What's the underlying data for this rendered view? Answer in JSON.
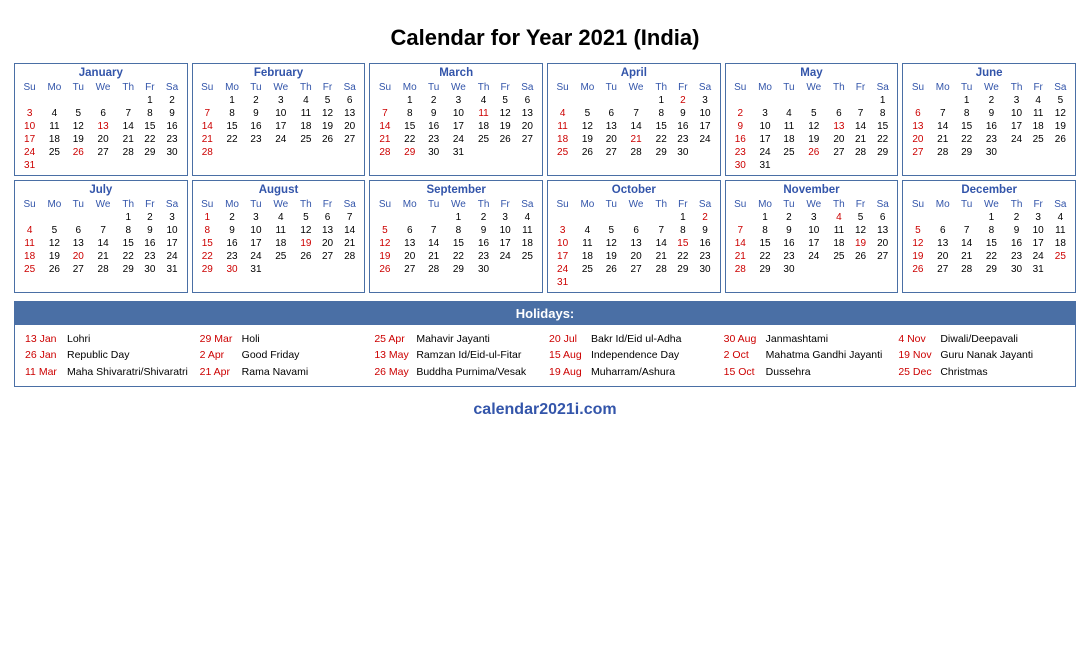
{
  "title": "Calendar for Year 2021 (India)",
  "months": [
    {
      "name": "January",
      "weeks": [
        [
          "",
          "",
          "",
          "",
          "",
          "1",
          "2"
        ],
        [
          "3",
          "4",
          "5",
          "6",
          "7",
          "8",
          "9"
        ],
        [
          "10",
          "11",
          "12",
          "13r",
          "14",
          "15",
          "16"
        ],
        [
          "17",
          "18",
          "19",
          "20",
          "21",
          "22",
          "23"
        ],
        [
          "24",
          "25",
          "26r",
          "27",
          "28",
          "29",
          "30"
        ],
        [
          "31",
          "",
          "",
          "",
          "",
          "",
          ""
        ]
      ]
    },
    {
      "name": "February",
      "weeks": [
        [
          "",
          "1",
          "2",
          "3",
          "4",
          "5",
          "6"
        ],
        [
          "7",
          "8",
          "9",
          "10",
          "11",
          "12",
          "13"
        ],
        [
          "14",
          "15",
          "16",
          "17",
          "18",
          "19",
          "20"
        ],
        [
          "21",
          "22",
          "23",
          "24",
          "25",
          "26",
          "27"
        ],
        [
          "28",
          "",
          "",
          "",
          "",
          "",
          ""
        ]
      ]
    },
    {
      "name": "March",
      "weeks": [
        [
          "",
          "1",
          "2",
          "3",
          "4",
          "5",
          "6"
        ],
        [
          "7",
          "8",
          "9",
          "10",
          "11r",
          "12",
          "13"
        ],
        [
          "14",
          "15",
          "16",
          "17",
          "18",
          "19",
          "20"
        ],
        [
          "21",
          "22",
          "23",
          "24",
          "25",
          "26",
          "27"
        ],
        [
          "28",
          "29r",
          "30",
          "31",
          "",
          "",
          ""
        ]
      ]
    },
    {
      "name": "April",
      "weeks": [
        [
          "",
          "",
          "",
          "",
          "1",
          "2r",
          "3"
        ],
        [
          "4",
          "5",
          "6",
          "7",
          "8",
          "9",
          "10"
        ],
        [
          "11",
          "12",
          "13",
          "14",
          "15",
          "16",
          "17"
        ],
        [
          "18",
          "19",
          "20",
          "21r",
          "22",
          "23",
          "24"
        ],
        [
          "25r",
          "26",
          "27",
          "28",
          "29",
          "30",
          ""
        ]
      ]
    },
    {
      "name": "May",
      "weeks": [
        [
          "",
          "",
          "",
          "",
          "",
          "",
          "1"
        ],
        [
          "2",
          "3",
          "4",
          "5",
          "6",
          "7",
          "8"
        ],
        [
          "9",
          "10",
          "11",
          "12",
          "13r",
          "14",
          "15"
        ],
        [
          "16",
          "17",
          "18",
          "19",
          "20",
          "21",
          "22"
        ],
        [
          "23",
          "24",
          "25",
          "26r",
          "27",
          "28",
          "29"
        ],
        [
          "30",
          "31",
          "",
          "",
          "",
          "",
          ""
        ]
      ]
    },
    {
      "name": "June",
      "weeks": [
        [
          "",
          "",
          "1",
          "2",
          "3",
          "4",
          "5"
        ],
        [
          "6",
          "7",
          "8",
          "9",
          "10",
          "11",
          "12"
        ],
        [
          "13",
          "14",
          "15",
          "16",
          "17",
          "18",
          "19"
        ],
        [
          "20",
          "21",
          "22",
          "23",
          "24",
          "25",
          "26"
        ],
        [
          "27",
          "28",
          "29",
          "30",
          "",
          "",
          ""
        ]
      ]
    },
    {
      "name": "July",
      "weeks": [
        [
          "",
          "",
          "",
          "",
          "1",
          "2",
          "3"
        ],
        [
          "4",
          "5",
          "6",
          "7",
          "8",
          "9",
          "10"
        ],
        [
          "11",
          "12",
          "13",
          "14",
          "15",
          "16",
          "17"
        ],
        [
          "18",
          "19",
          "20r",
          "21",
          "22",
          "23",
          "24"
        ],
        [
          "25",
          "26",
          "27",
          "28",
          "29",
          "30",
          "31"
        ]
      ]
    },
    {
      "name": "August",
      "weeks": [
        [
          "1",
          "2",
          "3",
          "4",
          "5",
          "6",
          "7"
        ],
        [
          "8",
          "9",
          "10",
          "11",
          "12",
          "13",
          "14"
        ],
        [
          "15r",
          "16",
          "17",
          "18",
          "19r",
          "20",
          "21"
        ],
        [
          "22",
          "23",
          "24",
          "25",
          "26",
          "27",
          "28"
        ],
        [
          "29",
          "30r",
          "31",
          "",
          "",
          "",
          ""
        ]
      ]
    },
    {
      "name": "September",
      "weeks": [
        [
          "",
          "",
          "",
          "1",
          "2",
          "3",
          "4"
        ],
        [
          "5",
          "6",
          "7",
          "8",
          "9",
          "10",
          "11"
        ],
        [
          "12",
          "13",
          "14",
          "15",
          "16",
          "17",
          "18"
        ],
        [
          "19",
          "20",
          "21",
          "22",
          "23",
          "24",
          "25"
        ],
        [
          "26",
          "27",
          "28",
          "29",
          "30",
          "",
          ""
        ]
      ]
    },
    {
      "name": "October",
      "weeks": [
        [
          "",
          "",
          "",
          "",
          "",
          "1",
          "2r"
        ],
        [
          "3",
          "4",
          "5",
          "6",
          "7",
          "8",
          "9"
        ],
        [
          "10",
          "11",
          "12",
          "13",
          "14",
          "15r",
          "16"
        ],
        [
          "17",
          "18",
          "19",
          "20",
          "21",
          "22",
          "23"
        ],
        [
          "24",
          "25",
          "26",
          "27",
          "28",
          "29",
          "30"
        ],
        [
          "31",
          "",
          "",
          "",
          "",
          "",
          ""
        ]
      ]
    },
    {
      "name": "November",
      "weeks": [
        [
          "",
          "1",
          "2",
          "3",
          "4r",
          "5",
          "6"
        ],
        [
          "7",
          "8",
          "9",
          "10",
          "11",
          "12",
          "13"
        ],
        [
          "14",
          "15",
          "16",
          "17",
          "18",
          "19r",
          "20"
        ],
        [
          "21",
          "22",
          "23",
          "24",
          "25",
          "26",
          "27"
        ],
        [
          "28",
          "29",
          "30",
          "",
          "",
          "",
          ""
        ]
      ]
    },
    {
      "name": "December",
      "weeks": [
        [
          "",
          "",
          "",
          "1",
          "2",
          "3",
          "4"
        ],
        [
          "5",
          "6",
          "7",
          "8",
          "9",
          "10",
          "11"
        ],
        [
          "12",
          "13",
          "14",
          "15",
          "16",
          "17",
          "18"
        ],
        [
          "19",
          "20",
          "21",
          "22",
          "23",
          "24",
          "25r"
        ],
        [
          "26",
          "27",
          "28",
          "29",
          "30",
          "31",
          ""
        ]
      ]
    }
  ],
  "days_header": [
    "Su",
    "Mo",
    "Tu",
    "We",
    "Th",
    "Fr",
    "Sa"
  ],
  "holidays_title": "Holidays:",
  "holiday_columns": [
    [
      {
        "date": "13 Jan",
        "name": "Lohri"
      },
      {
        "date": "26 Jan",
        "name": "Republic Day"
      },
      {
        "date": "11 Mar",
        "name": "Maha Shivaratri/Shivaratri"
      }
    ],
    [
      {
        "date": "29 Mar",
        "name": "Holi"
      },
      {
        "date": "2 Apr",
        "name": "Good Friday"
      },
      {
        "date": "21 Apr",
        "name": "Rama Navami"
      }
    ],
    [
      {
        "date": "25 Apr",
        "name": "Mahavir Jayanti"
      },
      {
        "date": "13 May",
        "name": "Ramzan Id/Eid-ul-Fitar"
      },
      {
        "date": "26 May",
        "name": "Buddha Purnima/Vesak"
      }
    ],
    [
      {
        "date": "20 Jul",
        "name": "Bakr Id/Eid ul-Adha"
      },
      {
        "date": "15 Aug",
        "name": "Independence Day"
      },
      {
        "date": "19 Aug",
        "name": "Muharram/Ashura"
      }
    ],
    [
      {
        "date": "30 Aug",
        "name": "Janmashtami"
      },
      {
        "date": "2 Oct",
        "name": "Mahatma Gandhi Jayanti"
      },
      {
        "date": "15 Oct",
        "name": "Dussehra"
      }
    ],
    [
      {
        "date": "4 Nov",
        "name": "Diwali/Deepavali"
      },
      {
        "date": "19 Nov",
        "name": "Guru Nanak Jayanti"
      },
      {
        "date": "25 Dec",
        "name": "Christmas"
      }
    ]
  ],
  "footer": "calendar2021i.com"
}
